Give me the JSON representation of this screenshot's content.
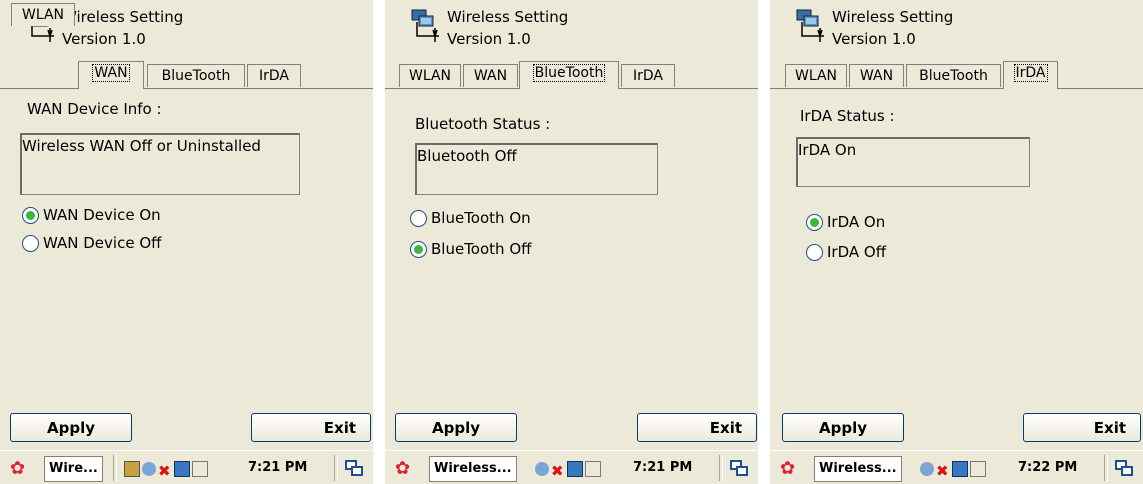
{
  "app": {
    "title": "Wireless Setting",
    "version": "Version 1.0"
  },
  "tabs": [
    "WLAN",
    "WAN",
    "BlueTooth",
    "IrDA"
  ],
  "buttons": {
    "apply": "Apply",
    "exit": "Exit"
  },
  "screens": [
    {
      "active_tab": "WAN",
      "info_label": "WAN Device Info :",
      "status_value": "Wireless WAN Off or Uninstalled",
      "options": [
        {
          "label": "WAN Device On",
          "checked": true
        },
        {
          "label": "WAN Device Off",
          "checked": false
        }
      ],
      "taskbar": {
        "window_label": "Wire...",
        "clock": "7:21 PM"
      }
    },
    {
      "active_tab": "BlueTooth",
      "info_label": "Bluetooth Status :",
      "status_value": "Bluetooth Off",
      "options": [
        {
          "label": "BlueTooth On",
          "checked": false
        },
        {
          "label": "BlueTooth Off",
          "checked": true
        }
      ],
      "taskbar": {
        "window_label": "Wireless...",
        "clock": "7:21 PM"
      }
    },
    {
      "active_tab": "IrDA",
      "info_label": "IrDA Status :",
      "status_value": "IrDA On",
      "options": [
        {
          "label": "IrDA On",
          "checked": true
        },
        {
          "label": "IrDA Off",
          "checked": false
        }
      ],
      "taskbar": {
        "window_label": "Wireless...",
        "clock": "7:22 PM"
      }
    }
  ],
  "colors": {
    "background": "#ece9d8",
    "radio_fill": "#3fb33b",
    "radio_border": "#1c5180"
  },
  "icons": [
    "network-computer-icon",
    "windows-start-icon",
    "network-tray-icon",
    "disconnected-x-icon",
    "keyboard-icon",
    "input-panel-icon",
    "switch-window-icon"
  ]
}
